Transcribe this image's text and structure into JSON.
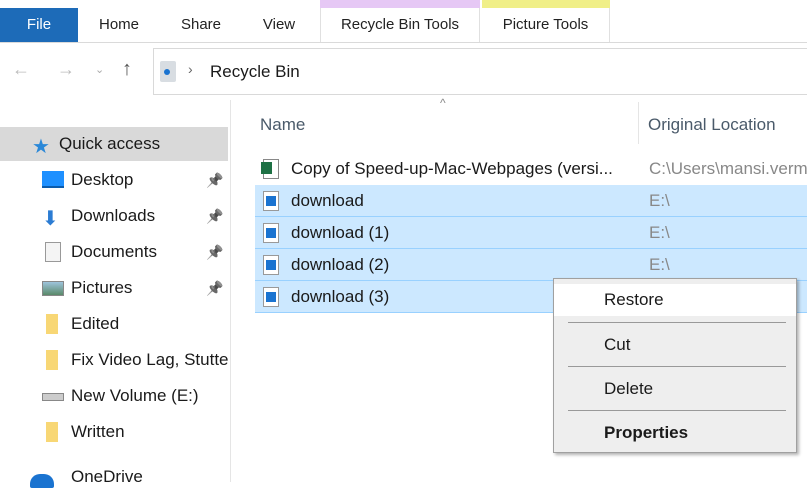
{
  "ribbon": {
    "tabs": [
      "File",
      "Home",
      "Share",
      "View",
      "Recycle Bin Tools",
      "Picture Tools"
    ],
    "context_colors": {
      "recycle": "#e6c8f5",
      "picture": "#f0ef88"
    },
    "file_color": "#1d6bb8"
  },
  "address": {
    "path": "Recycle Bin"
  },
  "nav": {
    "items": [
      {
        "label": "Quick access",
        "icon": "star-icon"
      },
      {
        "label": "Desktop",
        "icon": "desktop-icon",
        "pinned": true
      },
      {
        "label": "Downloads",
        "icon": "download-arrow-icon",
        "pinned": true
      },
      {
        "label": "Documents",
        "icon": "documents-icon",
        "pinned": true
      },
      {
        "label": "Pictures",
        "icon": "pictures-icon",
        "pinned": true
      },
      {
        "label": "Edited",
        "icon": "folder-icon"
      },
      {
        "label": "Fix Video Lag, Stutte",
        "icon": "folder-icon"
      },
      {
        "label": "New Volume (E:)",
        "icon": "drive-icon"
      },
      {
        "label": "Written",
        "icon": "folder-icon"
      },
      {
        "label": "OneDrive",
        "icon": "cloud-icon"
      }
    ]
  },
  "columns": {
    "name": "Name",
    "location": "Original Location"
  },
  "files": [
    {
      "name": "Copy of Speed-up-Mac-Webpages (versi...",
      "location": "C:\\Users\\mansi.verm",
      "selected": false
    },
    {
      "name": "download",
      "location": "E:\\",
      "selected": true
    },
    {
      "name": "download (1)",
      "location": "E:\\",
      "selected": true
    },
    {
      "name": "download (2)",
      "location": "E:\\",
      "selected": true
    },
    {
      "name": "download (3)",
      "location": "",
      "selected": true
    }
  ],
  "context_menu": {
    "items": [
      "Restore",
      "Cut",
      "Delete",
      "Properties"
    ]
  }
}
